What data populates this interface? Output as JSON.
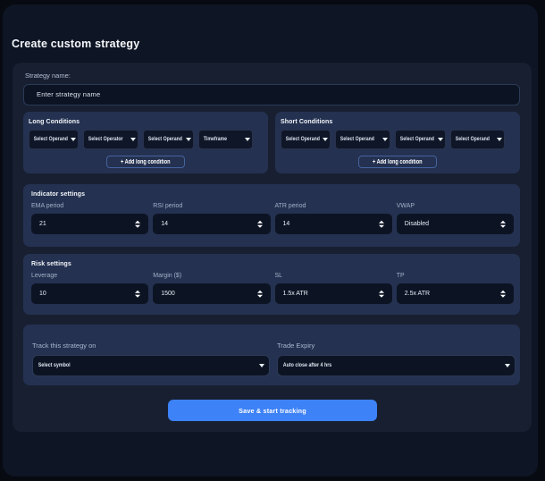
{
  "page": {
    "title": "Create custom strategy"
  },
  "strategy_name": {
    "label": "Strategy name:",
    "placeholder": "Enter strategy name"
  },
  "long_conditions": {
    "title": "Long Conditions",
    "dropdowns": [
      "Select Operand",
      "Select Operator",
      "Select Operand",
      "Timeframe"
    ],
    "add_button": "+ Add long condition"
  },
  "short_conditions": {
    "title": "Short Conditions",
    "dropdowns": [
      "Select Operand",
      "Select Operand",
      "Select Operand",
      "Select Operand"
    ],
    "add_button": "+ Add long condition"
  },
  "indicator_settings": {
    "title": "Indicator settings",
    "fields": [
      {
        "label": "EMA period",
        "value": "21"
      },
      {
        "label": "RSI period",
        "value": "14"
      },
      {
        "label": "ATR period",
        "value": "14"
      },
      {
        "label": "VWAP",
        "value": "Disabled"
      }
    ]
  },
  "risk_settings": {
    "title": "Risk settings",
    "fields": [
      {
        "label": "Leverage",
        "value": "10"
      },
      {
        "label": "Margin ($)",
        "value": "1500"
      },
      {
        "label": "SL",
        "value": "1.5x ATR"
      },
      {
        "label": "TP",
        "value": "2.5x ATR"
      }
    ]
  },
  "tracking": {
    "symbol": {
      "label": "Track this strategy on",
      "value": "Select symbol"
    },
    "expiry": {
      "label": "Trade Expiry",
      "value": "Auto close after 4 hrs"
    }
  },
  "save_button": "Save & start tracking",
  "colors": {
    "accent": "#3d82f7",
    "panel": "#243150",
    "card": "#171f31",
    "background": "#0e1524"
  }
}
